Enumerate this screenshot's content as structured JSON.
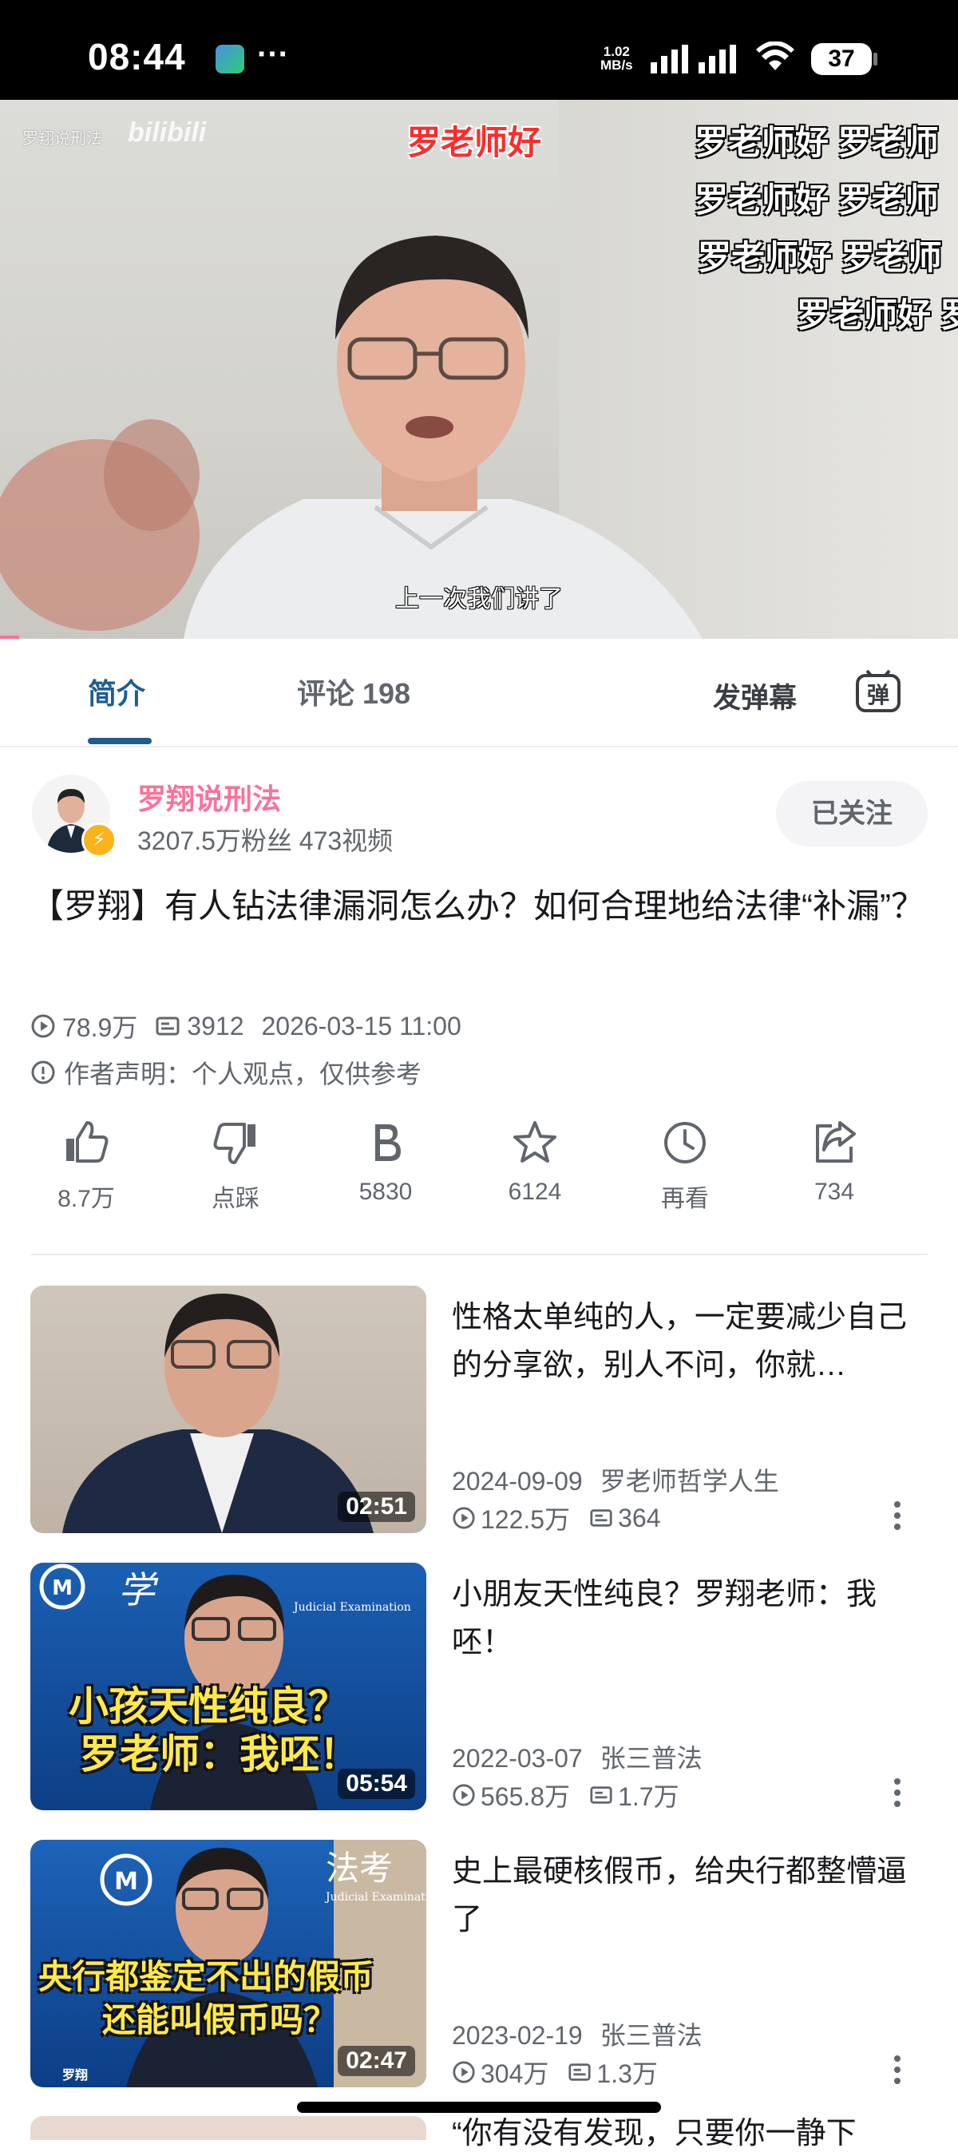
{
  "status_bar": {
    "time": "08:44",
    "more": "···",
    "net_speed_value": "1.02",
    "net_speed_unit": "MB/s",
    "battery": "37"
  },
  "video": {
    "channel_watermark": "罗翔说刑法",
    "platform_watermark": "bilibili",
    "subtitle": "上一次我们讲了",
    "progress": 0.02,
    "danmaku": [
      {
        "text": "罗老师好",
        "style": "red"
      },
      {
        "text": "罗老师好  罗老师",
        "style": "white"
      },
      {
        "text": "罗老师好  罗老师",
        "style": "white"
      },
      {
        "text": "罗老师好  罗老师",
        "style": "white"
      },
      {
        "text": "罗老师好  罗",
        "style": "white"
      }
    ]
  },
  "tabs": {
    "intro": "简介",
    "comments": "评论 198",
    "send_danmaku": "发弹幕",
    "danmaku_toggle": "弹"
  },
  "uploader": {
    "name": "罗翔说刑法",
    "stats": "3207.5万粉丝    473视频",
    "follow_label": "已关注"
  },
  "video_info": {
    "title": "【罗翔】有人钻法律漏洞怎么办？如何合理地给法律“补漏”？",
    "views": "78.9万",
    "danmaku_count": "3912",
    "date": "2026-03-15 11:00",
    "statement": "作者声明：个人观点，仅供参考"
  },
  "actions": [
    {
      "name": "like",
      "label": "8.7万"
    },
    {
      "name": "dislike",
      "label": "点踩"
    },
    {
      "name": "coin",
      "label": "5830"
    },
    {
      "name": "favorite",
      "label": "6124"
    },
    {
      "name": "watch-later",
      "label": "再看"
    },
    {
      "name": "share",
      "label": "734"
    }
  ],
  "recommended": [
    {
      "title": "性格太单纯的人，一定要减少自己的分享欲，别人不问，你就…",
      "duration": "02:51",
      "date": "2024-09-09",
      "author": "罗老师哲学人生",
      "views": "122.5万",
      "danmaku": "364",
      "thumb_text": []
    },
    {
      "title": "小朋友天性纯良？罗翔老师：我呸！",
      "duration": "05:54",
      "date": "2022-03-07",
      "author": "张三普法",
      "views": "565.8万",
      "danmaku": "1.7万",
      "thumb_text": [
        "小孩天性纯良？",
        "罗老师：我呸！"
      ],
      "thumb_header": "学",
      "thumb_sub": "Judicial Examination"
    },
    {
      "title": "史上最硬核假币，给央行都整懵逼了",
      "duration": "02:47",
      "date": "2023-02-19",
      "author": "张三普法",
      "views": "304万",
      "danmaku": "1.3万",
      "thumb_text": [
        "央行都鉴定不出的假币",
        "还能叫假币吗？"
      ],
      "thumb_header": "法考",
      "thumb_sub": "Judicial Examination",
      "thumb_name": "罗翔"
    }
  ],
  "peek_title": "“你有没有发现，只要你一静下"
}
